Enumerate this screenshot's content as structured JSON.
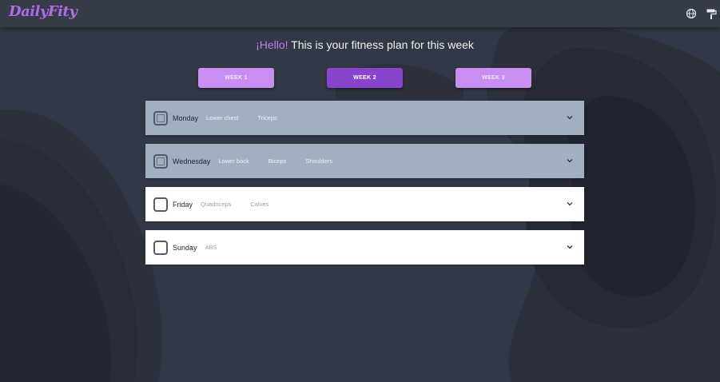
{
  "app": {
    "logo": "DailyFity",
    "icons": {
      "language": "globe-icon",
      "theme": "paint-roller-icon"
    }
  },
  "headline": {
    "greeting": "¡Hello!",
    "text": " This is your fitness plan for this week"
  },
  "weeks": [
    {
      "label": "WEEK 1",
      "active": false
    },
    {
      "label": "WEEK 2",
      "active": true
    },
    {
      "label": "WEEK 3",
      "active": false
    }
  ],
  "days": [
    {
      "name": "Monday",
      "muscles": [
        "Lower chest",
        "Triceps"
      ],
      "checked": true
    },
    {
      "name": "Wednesday",
      "muscles": [
        "Lower back",
        "Biceps",
        "Shoulders"
      ],
      "checked": true
    },
    {
      "name": "Friday",
      "muscles": [
        "Quadriceps",
        "Calves"
      ],
      "checked": false
    },
    {
      "name": "Sunday",
      "muscles": [
        "ABS"
      ],
      "checked": false
    }
  ],
  "colors": {
    "background": "#323845",
    "accent": "#8844cc",
    "accent_light": "#c88ef2",
    "completed_card": "#a1b0c1"
  }
}
